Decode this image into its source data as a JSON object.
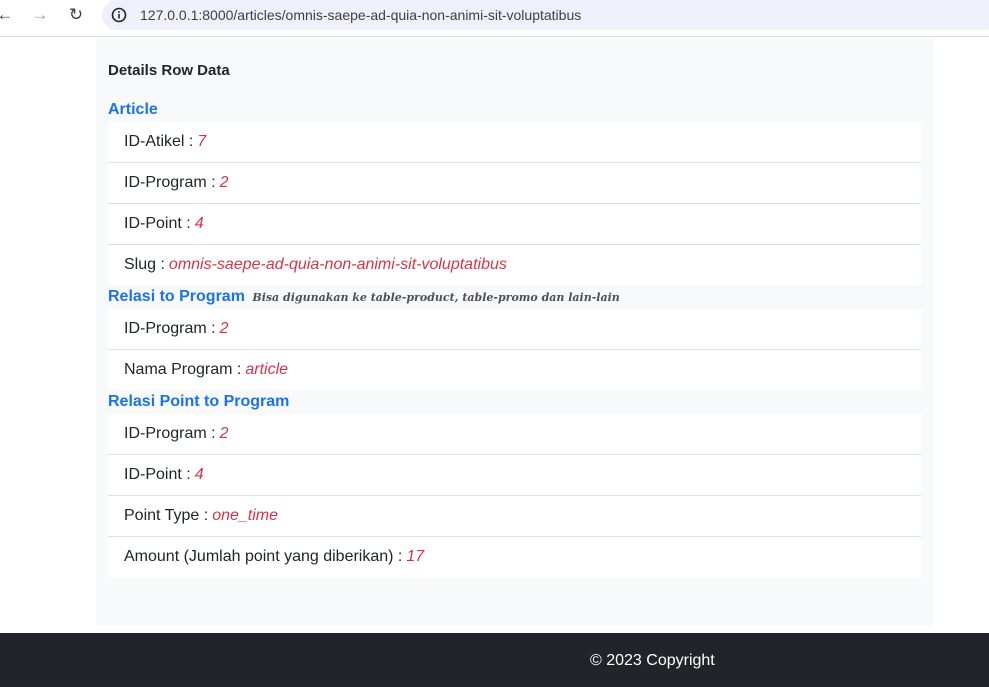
{
  "browser": {
    "url": "127.0.0.1:8000/articles/omnis-saepe-ad-quia-non-animi-sit-voluptatibus"
  },
  "page": {
    "title": "Details Row Data"
  },
  "sections": {
    "article": {
      "heading": "Article",
      "rows": [
        {
          "label": "ID-Atikel :",
          "value": "7"
        },
        {
          "label": "ID-Program :",
          "value": "2"
        },
        {
          "label": "ID-Point :",
          "value": "4"
        },
        {
          "label": "Slug :",
          "value": "omnis-saepe-ad-quia-non-animi-sit-voluptatibus"
        }
      ]
    },
    "program": {
      "heading": "Relasi to Program",
      "note": "Bisa digunakan ke table-product, table-promo dan lain-lain",
      "rows": [
        {
          "label": "ID-Program :",
          "value": "2"
        },
        {
          "label": "Nama Program :",
          "value": "article"
        }
      ]
    },
    "point": {
      "heading": "Relasi Point to Program",
      "rows": [
        {
          "label": "ID-Program :",
          "value": "2"
        },
        {
          "label": "ID-Point :",
          "value": "4"
        },
        {
          "label": "Point Type :",
          "value": "one_time"
        },
        {
          "label": "Amount (Jumlah point yang diberikan) :",
          "value": "17"
        }
      ]
    }
  },
  "footer": {
    "text": "© 2023 Copyright"
  },
  "colors": {
    "heading_blue": "#1a73e8",
    "value_red": "#d63447",
    "footer_bg": "#212529",
    "panel_bg": "#f8f9fa"
  }
}
